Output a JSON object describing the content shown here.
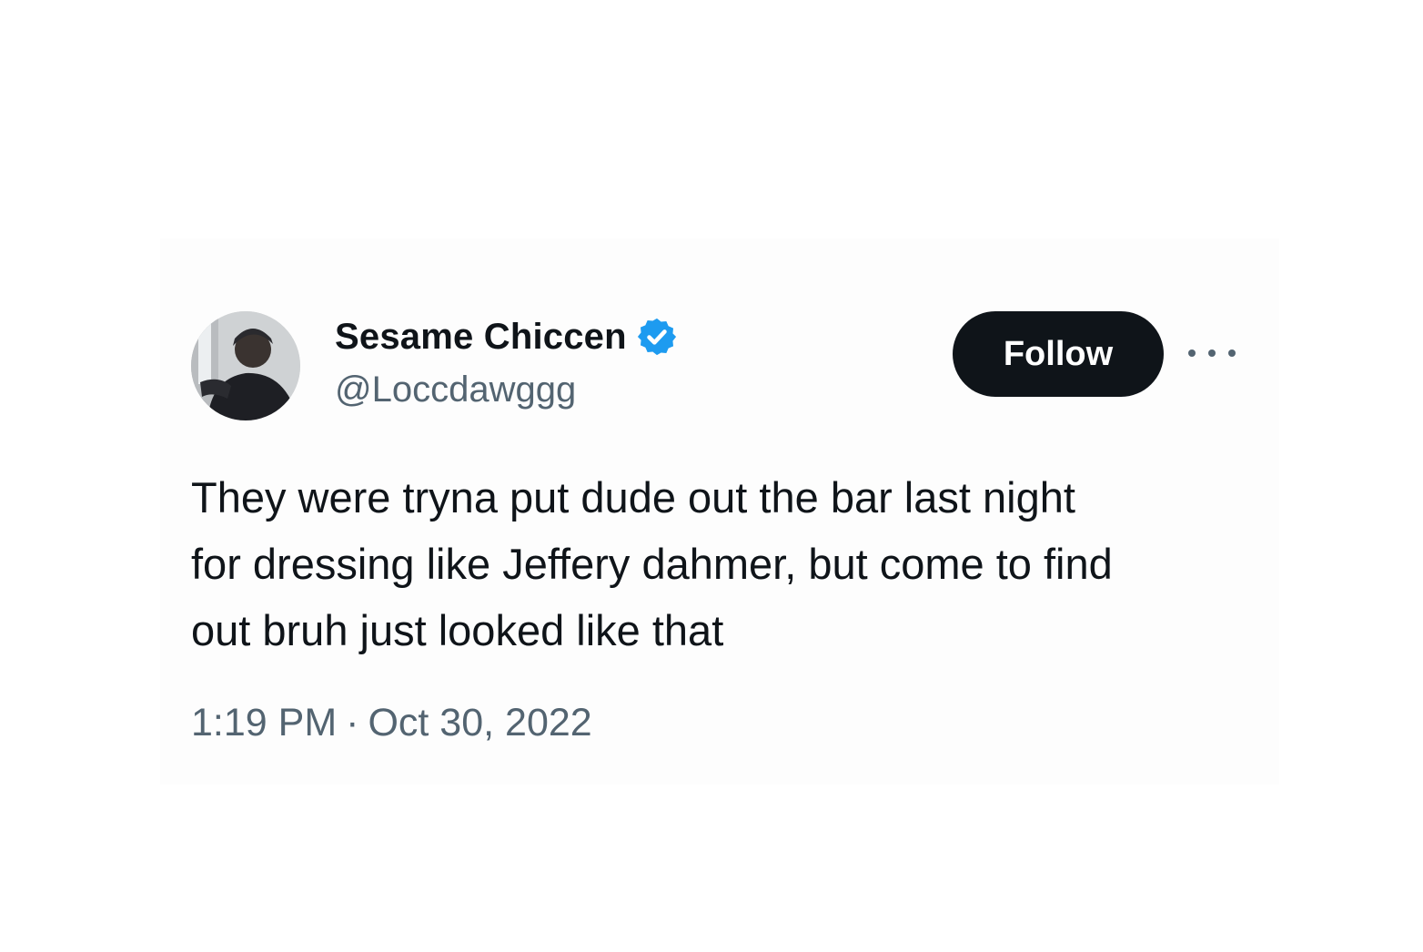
{
  "tweet": {
    "author": {
      "display_name": "Sesame Chiccen",
      "handle": "@Loccdawggg",
      "verified": true,
      "avatar_icon": "profile-photo"
    },
    "actions": {
      "follow_label": "Follow",
      "more_icon": "more-horizontal-icon"
    },
    "text_lines": [
      "They were tryna put dude out the bar last night",
      "for dressing like Jeffery dahmer, but come to find",
      "out bruh just looked like that"
    ],
    "time": "1:19 PM",
    "separator": "·",
    "date": "Oct 30, 2022"
  },
  "colors": {
    "primary_text": "#0f1419",
    "secondary_text": "#536471",
    "verified_blue": "#1d9bf0",
    "follow_bg": "#0f1419",
    "follow_text": "#ffffff"
  }
}
